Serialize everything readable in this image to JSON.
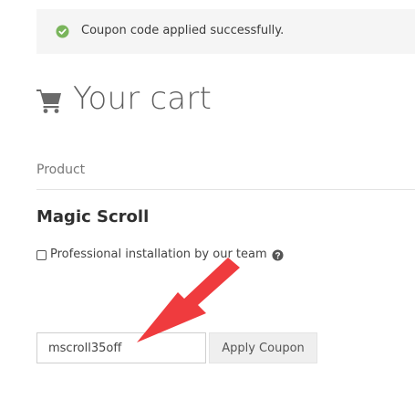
{
  "notice": {
    "message": "Coupon code applied successfully.",
    "icon": "check-circle-icon",
    "icon_color": "#7ab55c"
  },
  "cart": {
    "title": "Your cart",
    "icon": "shopping-cart-icon"
  },
  "table": {
    "product_header": "Product"
  },
  "item": {
    "name": "Magic Scroll",
    "install_option": {
      "label": "Professional installation by our team",
      "checked": false,
      "help_icon": "question-circle-icon"
    }
  },
  "coupon": {
    "code": "mscroll35off",
    "apply_label": "Apply Coupon"
  },
  "annotation": {
    "arrow_color": "#ef3b3e"
  }
}
